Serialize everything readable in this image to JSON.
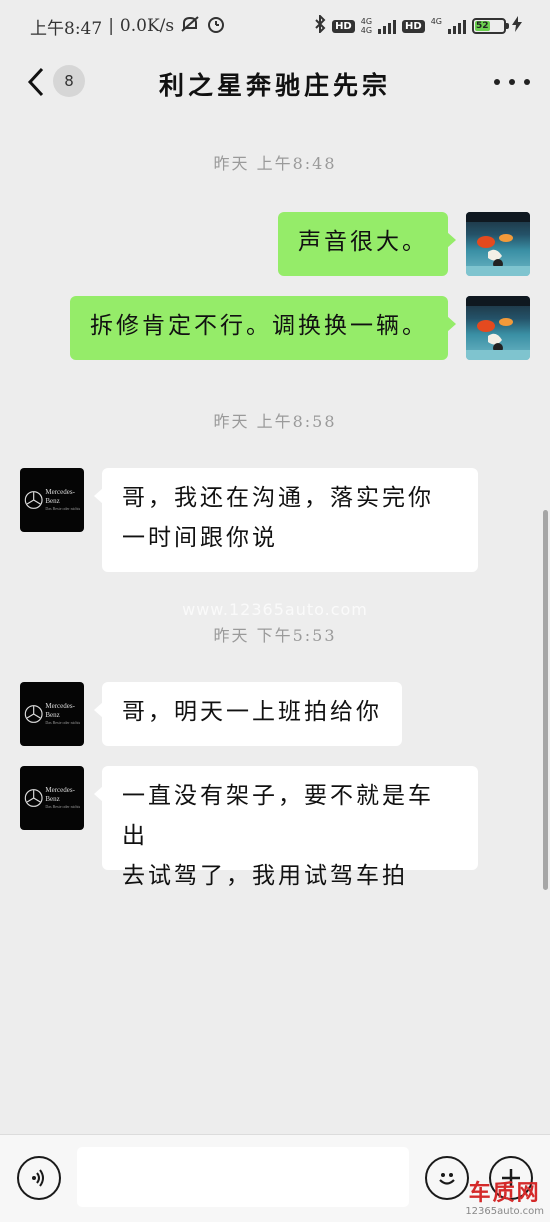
{
  "status_bar": {
    "time": "上午8:47",
    "speed": "0.0K/s",
    "hd1": "HD",
    "net1": "4G",
    "net1_sub": "4G",
    "hd2": "HD",
    "net2": "4G",
    "battery": "52",
    "battery_level": 0.52
  },
  "header": {
    "back_label": "",
    "unread_count": "8",
    "title": "利之星奔驰庄先宗"
  },
  "messages": {
    "ts1": "昨天 上午8:48",
    "m1": "声音很大。",
    "m2": "拆修肯定不行。调换换一辆。",
    "ts2": "昨天 上午8:58",
    "m3_line1": "哥，我还在沟通，落实完你",
    "m3_line2": "一时间跟你说",
    "ts3": "昨天 下午5:53",
    "m4": "哥，明天一上班拍给你",
    "m5_line1": "一直没有架子，要不就是车出",
    "m5_line2": "去试驾了，我用试驾车拍"
  },
  "watermark": "www.12365auto.com",
  "merc_logo": {
    "name": "Mercedes-Benz",
    "tagline": "Das Beste oder nichts"
  },
  "input_bar": {
    "text_value": ""
  },
  "corner_logo": {
    "name": "车质网",
    "url": "12365auto.com"
  },
  "colors": {
    "outgoing_bubble": "#95ec69",
    "incoming_bubble": "#ffffff",
    "background": "#ededed"
  }
}
